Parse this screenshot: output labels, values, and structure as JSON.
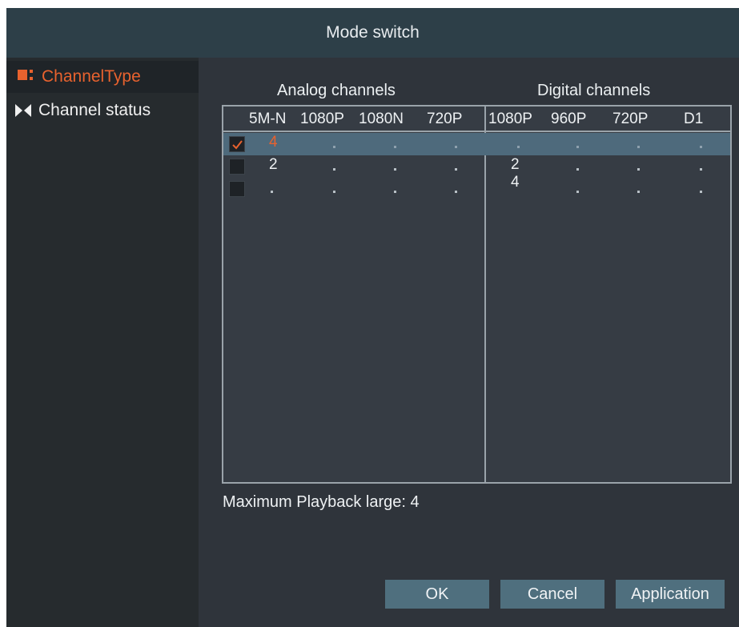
{
  "window": {
    "title": "Mode switch"
  },
  "sidebar": {
    "items": [
      {
        "label": "ChannelType",
        "icon": "channel-type-icon",
        "active": true
      },
      {
        "label": "Channel status",
        "icon": "channel-status-icon",
        "active": false
      }
    ]
  },
  "groups": {
    "analog": "Analog channels",
    "digital": "Digital channels"
  },
  "table": {
    "headers": [
      "5M-N",
      "1080P",
      "1080N",
      "720P",
      "1080P",
      "960P",
      "720P",
      "D1"
    ],
    "rows": [
      {
        "checked": true,
        "selected": true,
        "cells": [
          "4",
          ".",
          ".",
          ".",
          ".",
          ".",
          ".",
          "."
        ]
      },
      {
        "checked": false,
        "selected": false,
        "cells": [
          "2",
          ".",
          ".",
          ".",
          "2",
          ".",
          ".",
          "."
        ]
      },
      {
        "checked": false,
        "selected": false,
        "cells": [
          ".",
          ".",
          ".",
          ".",
          "4",
          ".",
          ".",
          "."
        ]
      }
    ]
  },
  "status": {
    "max_playback": "Maximum Playback large: 4"
  },
  "buttons": {
    "ok": "OK",
    "cancel": "Cancel",
    "apply": "Application"
  },
  "colors": {
    "accent": "#e8622e",
    "selected_row": "#4e6a7c",
    "button": "#4f6f7e",
    "title_bar": "#2d3f48"
  }
}
